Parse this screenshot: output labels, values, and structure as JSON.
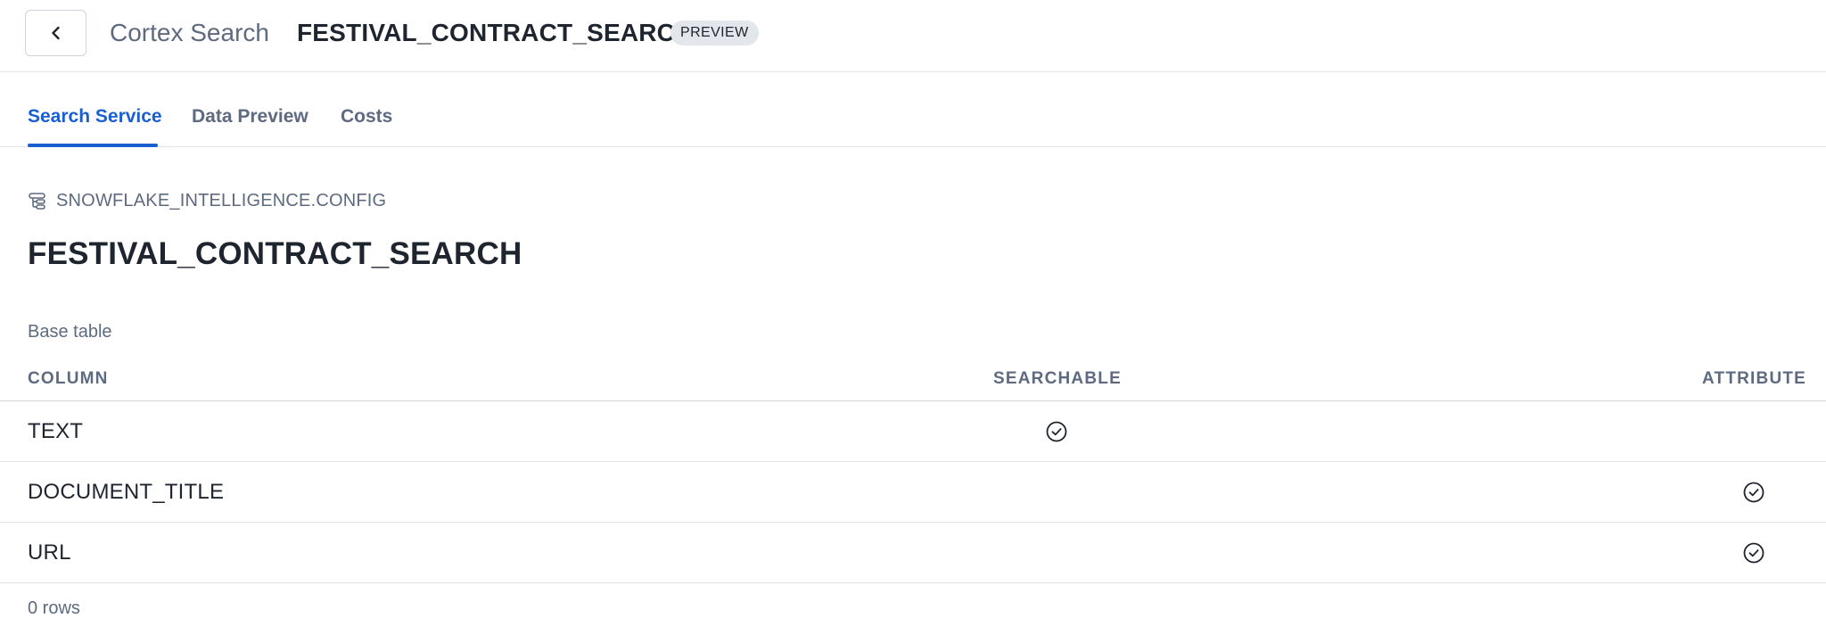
{
  "header": {
    "back_icon": "chevron-left-icon",
    "breadcrumb": "Cortex Search",
    "service_name": "FESTIVAL_CONTRACT_SEARCH",
    "badge": "PREVIEW"
  },
  "tabs": [
    {
      "label": "Search Service",
      "active": true
    },
    {
      "label": "Data Preview",
      "active": false
    },
    {
      "label": "Costs",
      "active": false
    }
  ],
  "main": {
    "schema_icon": "schema-icon",
    "schema_path": "SNOWFLAKE_INTELLIGENCE.CONFIG",
    "title": "FESTIVAL_CONTRACT_SEARCH",
    "section_label": "Base table",
    "table": {
      "headers": {
        "column": "COLUMN",
        "searchable": "SEARCHABLE",
        "attribute": "ATTRIBUTE"
      },
      "rows": [
        {
          "name": "TEXT",
          "searchable": true,
          "attribute": false
        },
        {
          "name": "DOCUMENT_TITLE",
          "searchable": false,
          "attribute": true
        },
        {
          "name": "URL",
          "searchable": false,
          "attribute": true
        }
      ],
      "row_count": "0 rows"
    }
  },
  "colors": {
    "accent": "#1a5fd1",
    "muted_text": "#5d6a80",
    "text": "#1e252f",
    "badge_bg": "#e3e6ea",
    "border": "#dfe2e7"
  }
}
